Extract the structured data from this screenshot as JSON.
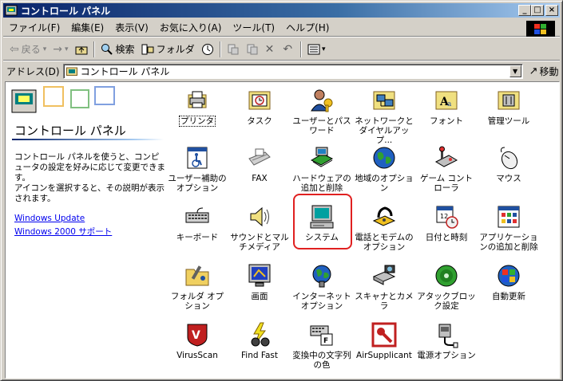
{
  "window": {
    "title": "コントロール パネル",
    "minimize_glyph": "_",
    "maximize_glyph": "□",
    "close_glyph": "×"
  },
  "menubar": {
    "items": [
      "ファイル(F)",
      "編集(E)",
      "表示(V)",
      "お気に入り(A)",
      "ツール(T)",
      "ヘルプ(H)"
    ]
  },
  "toolbar": {
    "back_label": "戻る",
    "forward_glyph": "→",
    "search_label": "検索",
    "folders_label": "フォルダ",
    "dropdown_glyph": "▾"
  },
  "address": {
    "label": "アドレス(D)",
    "value": "コントロール パネル",
    "go_label": "移動"
  },
  "left_panel": {
    "title": "コントロール パネル",
    "description_1": "コントロール パネルを使うと、コンピュータの設定を好みに応じて変更できます。",
    "description_2": "アイコンを選択すると、その説明が表示されます。",
    "links": [
      "Windows Update",
      "Windows 2000 サポート"
    ]
  },
  "icons": [
    {
      "label": "プリンタ",
      "icon": "printer-icon",
      "focused": true
    },
    {
      "label": "タスク",
      "icon": "scheduled-tasks-icon"
    },
    {
      "label": "ユーザーとパスワード",
      "icon": "users-passwords-icon"
    },
    {
      "label": "ネットワークとダイヤルアップ...",
      "icon": "network-dialup-icon"
    },
    {
      "label": "フォント",
      "icon": "fonts-icon"
    },
    {
      "label": "管理ツール",
      "icon": "admin-tools-icon"
    },
    {
      "label": "ユーザー補助のオプション",
      "icon": "accessibility-icon"
    },
    {
      "label": "FAX",
      "icon": "fax-icon"
    },
    {
      "label": "ハードウェアの追加と削除",
      "icon": "add-hardware-icon"
    },
    {
      "label": "地域のオプション",
      "icon": "regional-options-icon"
    },
    {
      "label": "ゲーム コントローラ",
      "icon": "game-controller-icon"
    },
    {
      "label": "マウス",
      "icon": "mouse-icon"
    },
    {
      "label": "キーボード",
      "icon": "keyboard-icon"
    },
    {
      "label": "サウンドとマルチメディア",
      "icon": "sound-multimedia-icon"
    },
    {
      "label": "システム",
      "icon": "system-icon"
    },
    {
      "label": "電話とモデムのオプション",
      "icon": "phone-modem-icon"
    },
    {
      "label": "日付と時刻",
      "icon": "date-time-icon"
    },
    {
      "label": "アプリケーションの追加と削除",
      "icon": "add-remove-programs-icon"
    },
    {
      "label": "フォルダ オプション",
      "icon": "folder-options-icon"
    },
    {
      "label": "画面",
      "icon": "display-icon"
    },
    {
      "label": "インターネット オプション",
      "icon": "internet-options-icon"
    },
    {
      "label": "スキャナとカメラ",
      "icon": "scanner-camera-icon"
    },
    {
      "label": "アタックブロック設定",
      "icon": "attack-block-icon"
    },
    {
      "label": "自動更新",
      "icon": "automatic-updates-icon"
    },
    {
      "label": "VirusScan",
      "icon": "virusscan-icon"
    },
    {
      "label": "Find Fast",
      "icon": "find-fast-icon"
    },
    {
      "label": "変換中の文字列の色",
      "icon": "ime-color-icon"
    },
    {
      "label": "AirSupplicant",
      "icon": "airsupplicant-icon"
    },
    {
      "label": "電源オプション",
      "icon": "power-options-icon"
    }
  ],
  "highlight_color": "#e02020"
}
